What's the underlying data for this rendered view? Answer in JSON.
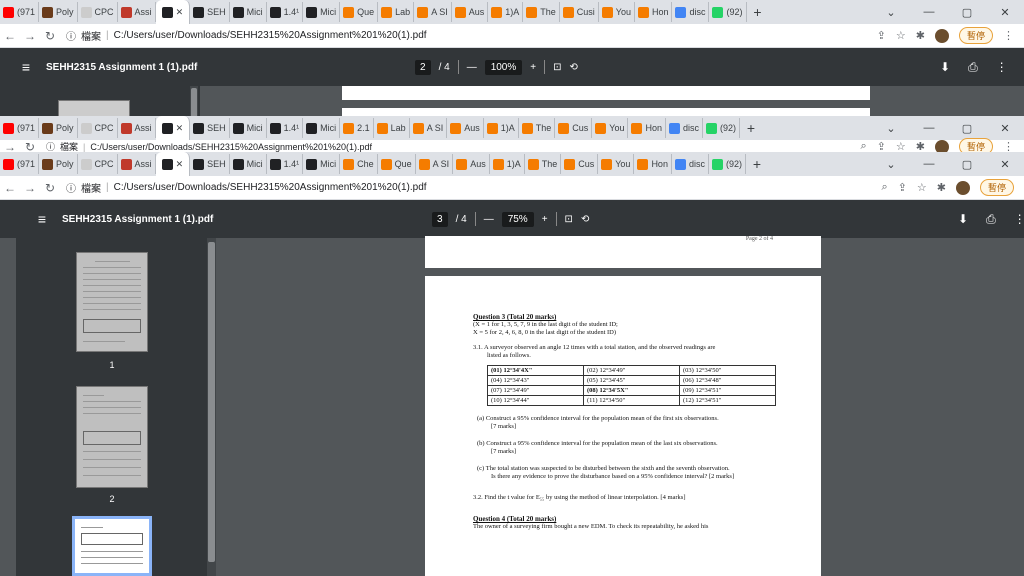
{
  "back_window": {
    "tabs": [
      {
        "label": "(971",
        "color": "#ff0000"
      },
      {
        "label": "Poly",
        "color": "#6a3b1a"
      },
      {
        "label": "CPC",
        "color": "#cccccc"
      },
      {
        "label": "Assi",
        "color": "#c0392b"
      },
      {
        "label": "",
        "color": "#202124"
      },
      {
        "label": "SEH",
        "color": "#202124"
      },
      {
        "label": "Mici",
        "color": "#202124"
      },
      {
        "label": "1.4¹",
        "color": "#202124"
      },
      {
        "label": "Mici",
        "color": "#202124"
      },
      {
        "label": "Que",
        "color": "#f57c00"
      },
      {
        "label": "Lab",
        "color": "#f57c00"
      },
      {
        "label": "A SI",
        "color": "#f57c00"
      },
      {
        "label": "Aus",
        "color": "#f57c00"
      },
      {
        "label": "1)A",
        "color": "#f57c00"
      },
      {
        "label": "The",
        "color": "#f57c00"
      },
      {
        "label": "Cusi",
        "color": "#f57c00"
      },
      {
        "label": "You",
        "color": "#f57c00"
      },
      {
        "label": "Hon",
        "color": "#f57c00"
      },
      {
        "label": "disc",
        "color": "#4285f4"
      },
      {
        "label": "(92)",
        "color": "#25d366"
      }
    ],
    "url_security": "檔案",
    "url": "C:/Users/user/Downloads/SEHH2315%20Assignment%201%20(1).pdf",
    "paused_label": "暫停",
    "pdf_title": "SEHH2315 Assignment 1 (1).pdf",
    "page_current": "2",
    "page_total": "/ 4",
    "zoom": "100%"
  },
  "middle_window": {
    "tabs": [
      {
        "label": "(971",
        "color": "#ff0000"
      },
      {
        "label": "Poly",
        "color": "#6a3b1a"
      },
      {
        "label": "CPC",
        "color": "#cccccc"
      },
      {
        "label": "Assi",
        "color": "#c0392b"
      },
      {
        "label": "",
        "color": "#202124"
      },
      {
        "label": "SEH",
        "color": "#202124"
      },
      {
        "label": "Mici",
        "color": "#202124"
      },
      {
        "label": "1.4¹",
        "color": "#202124"
      },
      {
        "label": "Mici",
        "color": "#202124"
      },
      {
        "label": "2.1",
        "color": "#f57c00"
      },
      {
        "label": "Lab",
        "color": "#f57c00"
      },
      {
        "label": "A SI",
        "color": "#f57c00"
      },
      {
        "label": "Aus",
        "color": "#f57c00"
      },
      {
        "label": "1)A",
        "color": "#f57c00"
      },
      {
        "label": "The",
        "color": "#f57c00"
      },
      {
        "label": "Cus",
        "color": "#f57c00"
      },
      {
        "label": "You",
        "color": "#f57c00"
      },
      {
        "label": "Hon",
        "color": "#f57c00"
      },
      {
        "label": "disc",
        "color": "#4285f4"
      },
      {
        "label": "(92)",
        "color": "#25d366"
      }
    ],
    "url_security": "檔案",
    "url": "C:/Users/user/Downloads/SEHH2315%20Assignment%201%20(1).pdf",
    "paused_label": "暫停"
  },
  "front_window": {
    "tabs": [
      {
        "label": "(971",
        "color": "#ff0000"
      },
      {
        "label": "Poly",
        "color": "#6a3b1a"
      },
      {
        "label": "CPC",
        "color": "#cccccc"
      },
      {
        "label": "Assi",
        "color": "#c0392b"
      },
      {
        "label": "",
        "color": "#202124"
      },
      {
        "label": "SEH",
        "color": "#202124"
      },
      {
        "label": "Mici",
        "color": "#202124"
      },
      {
        "label": "1.4¹",
        "color": "#202124"
      },
      {
        "label": "Mici",
        "color": "#202124"
      },
      {
        "label": "Che",
        "color": "#f57c00"
      },
      {
        "label": "Que",
        "color": "#f57c00"
      },
      {
        "label": "A SI",
        "color": "#f57c00"
      },
      {
        "label": "Aus",
        "color": "#f57c00"
      },
      {
        "label": "1)A",
        "color": "#f57c00"
      },
      {
        "label": "The",
        "color": "#f57c00"
      },
      {
        "label": "Cus",
        "color": "#f57c00"
      },
      {
        "label": "You",
        "color": "#f57c00"
      },
      {
        "label": "Hon",
        "color": "#f57c00"
      },
      {
        "label": "disc",
        "color": "#4285f4"
      },
      {
        "label": "(92)",
        "color": "#25d366"
      }
    ],
    "url_security": "檔案",
    "url": "C:/Users/user/Downloads/SEHH2315%20Assignment%201%20(1).pdf",
    "paused_label": "暫停",
    "pdf_title": "SEHH2315 Assignment 1 (1).pdf",
    "page_current": "3",
    "page_total": "/ 4",
    "zoom": "75%",
    "thumb_labels": [
      "1",
      "2"
    ],
    "page_footer": "Page 2 of 4"
  },
  "document": {
    "q3_title": "Question 3 (Total 20 marks)",
    "q3_x_line1": "(X = 1 for 1, 3, 5, 7, 9 in the last digit of the student ID;",
    "q3_x_line2": "X = 5 for 2, 4, 6, 8, 0 in the last digit of the student ID)",
    "q31_text": "3.1. A surveyor observed an angle 12 times with a total station, and the observed readings are",
    "q31_text2": "listed as follows.",
    "observations": [
      [
        "(01) 12°34'4X\"",
        "(02) 12°34'49\"",
        "(03) 12°34'50\""
      ],
      [
        "(04) 12°34'43\"",
        "(05) 12°34'45\"",
        "(06) 12°34'48\""
      ],
      [
        "(07) 12°34'49\"",
        "(08) 12°34'5X\"",
        "(09) 12°34'51\""
      ],
      [
        "(10) 12°34'44\"",
        "(11) 12°34'50\"",
        "(12) 12°34'51\""
      ]
    ],
    "qa_line1": "(a)  Construct a 95% confidence interval for the population mean of the first six observations.",
    "qa_line2": "[7 marks]",
    "qb_line1": "(b)  Construct a 95% confidence interval for the population mean of the last six observations.",
    "qb_line2": "[7 marks]",
    "qc_line1": "(c)  The total station was suspected to be disturbed between the sixth and the seventh observation.",
    "qc_line2": "Is there any evidence to prove the disturbance based on a 95% confidence interval? [2 marks]",
    "q32_text": "3.2. Find the t value for E₅₅ by using the method of linear interpolation. [4 marks]",
    "q4_title": "Question 4 (Total 20 marks)",
    "q4_text": "The owner of a surveying firm bought a new EDM. To check its repeatability, he asked his"
  }
}
